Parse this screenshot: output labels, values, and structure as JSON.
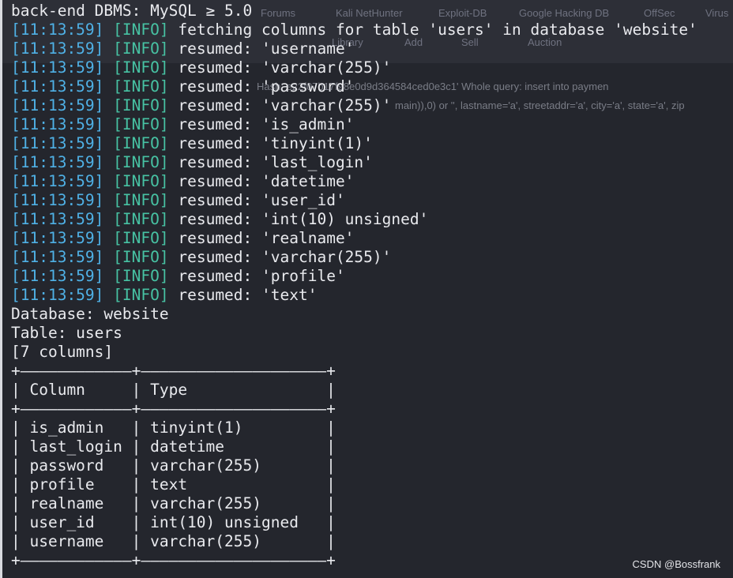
{
  "background_browser": {
    "bookmarks": [
      "Forums",
      "Kali NetHunter",
      "Exploit-DB",
      "Google Hacking DB",
      "OffSec",
      "Virus"
    ],
    "menu": [
      "Library",
      "Add",
      "Sell",
      "Auction"
    ],
    "error_text_1": "Hash: e22f07b17f98e0d9d364584ced0e3c1' Whole query: insert into paymen",
    "error_text_2": "main)),0) or '', lastname='a', streetaddr='a', city='a', state='a', zip"
  },
  "terminal": {
    "dbms_line": "back-end DBMS: MySQL ≥ 5.0",
    "log_lines": [
      {
        "time": "[11:13:59]",
        "level": "[INFO]",
        "message": "fetching columns for table 'users' in database 'website'"
      },
      {
        "time": "[11:13:59]",
        "level": "[INFO]",
        "message": "resumed: 'username'"
      },
      {
        "time": "[11:13:59]",
        "level": "[INFO]",
        "message": "resumed: 'varchar(255)'"
      },
      {
        "time": "[11:13:59]",
        "level": "[INFO]",
        "message": "resumed: 'password'"
      },
      {
        "time": "[11:13:59]",
        "level": "[INFO]",
        "message": "resumed: 'varchar(255)'"
      },
      {
        "time": "[11:13:59]",
        "level": "[INFO]",
        "message": "resumed: 'is_admin'"
      },
      {
        "time": "[11:13:59]",
        "level": "[INFO]",
        "message": "resumed: 'tinyint(1)'"
      },
      {
        "time": "[11:13:59]",
        "level": "[INFO]",
        "message": "resumed: 'last_login'"
      },
      {
        "time": "[11:13:59]",
        "level": "[INFO]",
        "message": "resumed: 'datetime'"
      },
      {
        "time": "[11:13:59]",
        "level": "[INFO]",
        "message": "resumed: 'user_id'"
      },
      {
        "time": "[11:13:59]",
        "level": "[INFO]",
        "message": "resumed: 'int(10) unsigned'"
      },
      {
        "time": "[11:13:59]",
        "level": "[INFO]",
        "message": "resumed: 'realname'"
      },
      {
        "time": "[11:13:59]",
        "level": "[INFO]",
        "message": "resumed: 'varchar(255)'"
      },
      {
        "time": "[11:13:59]",
        "level": "[INFO]",
        "message": "resumed: 'profile'"
      },
      {
        "time": "[11:13:59]",
        "level": "[INFO]",
        "message": "resumed: 'text'"
      }
    ],
    "database_line": "Database: website",
    "table_line": "Table: users",
    "columns_count_line": "[7 columns]",
    "table": {
      "border_top": "+————————————+————————————————————+",
      "header": "| Column     | Type               |",
      "border_mid": "+————————————+————————————————————+",
      "rows": [
        "| is_admin   | tinyint(1)         |",
        "| last_login | datetime           |",
        "| password   | varchar(255)       |",
        "| profile    | text               |",
        "| realname   | varchar(255)       |",
        "| user_id    | int(10) unsigned   |",
        "| username   | varchar(255)       |"
      ],
      "border_bottom": "+————————————+————————————————————+"
    }
  },
  "watermark": "CSDN @Bossfrank",
  "colors": {
    "background": "#24262d",
    "text": "#e9eaee",
    "timestamp": "#4fb1e6",
    "info_level": "#47c2a3"
  }
}
